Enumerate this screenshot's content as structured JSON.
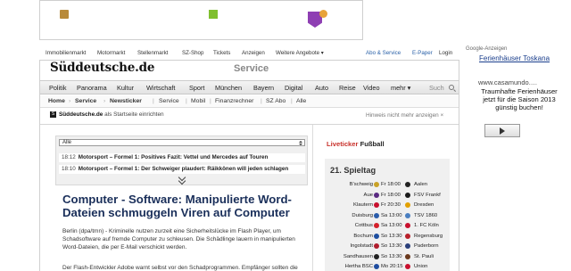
{
  "toplinks": {
    "items": [
      "Immobilienmarkt",
      "Motormarkt",
      "Stellenmarkt",
      "SZ-Shop",
      "Tickets",
      "Anzeigen",
      "Weitere Angebote ▾"
    ],
    "abo": "Abo & Service",
    "epaper": "E-Paper",
    "login": "Login"
  },
  "ad": {
    "label": "Google-Anzeigen",
    "title": "Ferienhäuser Toskana",
    "url": "www.casamundo.…",
    "text": "Traumhafte Ferienhäuser jetzt für die Saison 2013 günstig buchen!"
  },
  "header": {
    "logo": "Süddeutsche.de",
    "section": "Service"
  },
  "nav": {
    "items": [
      "Politik",
      "Panorama",
      "Kultur",
      "Wirtschaft",
      "Sport",
      "München",
      "Bayern",
      "Digital",
      "Auto",
      "Reise",
      "Video",
      "mehr ▾"
    ],
    "search_placeholder": "Such"
  },
  "breadcrumb": {
    "items": [
      "Home",
      "Service",
      "Newsticker",
      "Service",
      "Mobil",
      "Finanzrechner",
      "SZ Abo",
      "Alle"
    ]
  },
  "startpage": {
    "site": "Süddeutsche.de",
    "text": "als Startseite einrichten",
    "hint": "Hinweis nicht mehr anzeigen",
    "hint_icon": "close-icon"
  },
  "ticker": {
    "filter": "Alle",
    "rows": [
      {
        "time": "18:12",
        "text": "Motorsport – Formel 1: Positives Fazit: Vettel und Mercedes auf Touren"
      },
      {
        "time": "18:10",
        "text": "Motorsport – Formel 1: Der Schweiger plaudert: Räikkönen will jeden schlagen"
      }
    ]
  },
  "article": {
    "headline": "Computer - Software: Manipulierte Word-Dateien schmuggeln Viren auf Computer",
    "lead": "Berlin (dpa/tmn) - Kriminelle nutzen zurzeit eine Sicherheitslücke im Flash Player, um Schadsoftware auf fremde Computer zu schleusen. Die Schädlinge lauern in manipulierten Word-Dateien, die per E-Mail verschickt werden.",
    "para2": "Der Flash-Entwickler Adobe warnt selbst vor den Schadprogrammen. Empfänger sollten die"
  },
  "liveticker": {
    "label_red": "Liveticker",
    "label_dark": "Fußball",
    "spieltag": "21. Spieltag",
    "matches": [
      {
        "home": "B'schweig",
        "time": "Fr 18:00",
        "away": "Aalen",
        "home_color": "#c9a227",
        "away_color": "#222222"
      },
      {
        "home": "Aue",
        "time": "Fr 18:00",
        "away": "FSV Frankf",
        "home_color": "#5a2a82",
        "away_color": "#1a1a1a"
      },
      {
        "home": "Klautern",
        "time": "Fr 20:30",
        "away": "Dresden",
        "home_color": "#c8102e",
        "away_color": "#e2a000"
      },
      {
        "home": "Duisburg",
        "time": "Sa 13:00",
        "away": "TSV 1860",
        "home_color": "#2a5caa",
        "away_color": "#4a7fc1"
      },
      {
        "home": "Cottbus",
        "time": "Sa 13:00",
        "away": "1. FC Köln",
        "home_color": "#d4202a",
        "away_color": "#c8102e"
      },
      {
        "home": "Bochum",
        "time": "So 13:30",
        "away": "Regensburg",
        "home_color": "#1e4fa0",
        "away_color": "#b8202a"
      },
      {
        "home": "Ingolstadt",
        "time": "So 13:30",
        "away": "Paderborn",
        "home_color": "#b01e2e",
        "away_color": "#2a3f7a"
      },
      {
        "home": "Sandhausen",
        "time": "So 13:30",
        "away": "St. Pauli",
        "home_color": "#222222",
        "away_color": "#6b3a1e"
      },
      {
        "home": "Hertha BSC",
        "time": "Mo 20:15",
        "away": "Union",
        "home_color": "#1f4da0",
        "away_color": "#c8102e"
      }
    ]
  }
}
